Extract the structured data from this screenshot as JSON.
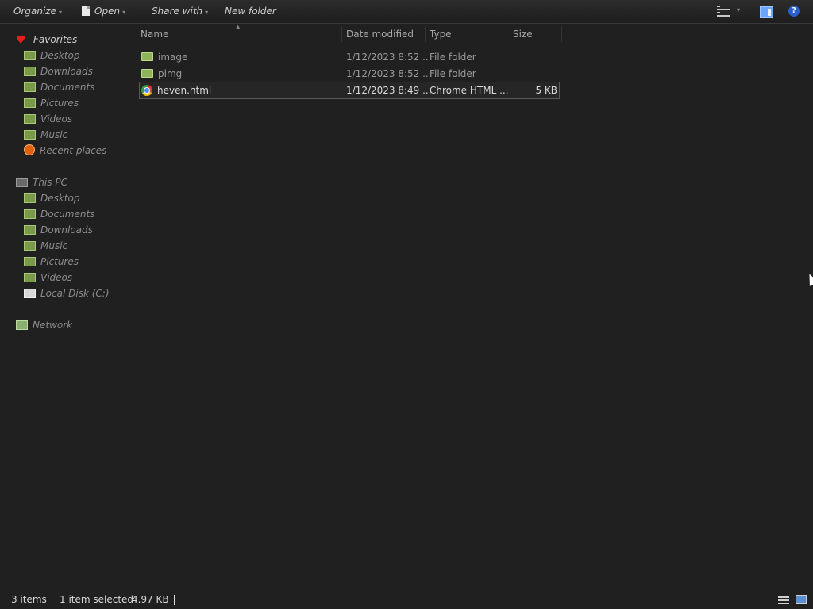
{
  "toolbar": {
    "organize": "Organize",
    "open": "Open",
    "share_with": "Share with",
    "new_folder": "New folder",
    "help_glyph": "?"
  },
  "nav": {
    "favorites": "Favorites",
    "favorites_items": [
      "Desktop",
      "Downloads",
      "Documents",
      "Pictures",
      "Videos",
      "Music",
      "Recent places"
    ],
    "this_pc": "This PC",
    "this_pc_items": [
      "Desktop",
      "Documents",
      "Downloads",
      "Music",
      "Pictures",
      "Videos",
      "Local Disk (C:)"
    ],
    "network": "Network"
  },
  "columns": {
    "name": "Name",
    "date_modified": "Date modified",
    "type": "Type",
    "size": "Size"
  },
  "files": [
    {
      "name": "image",
      "date": "1/12/2023 8:52 ...",
      "type": "File folder",
      "size": "",
      "icon": "folder-icon",
      "selected": false
    },
    {
      "name": "pimg",
      "date": "1/12/2023 8:52 ...",
      "type": "File folder",
      "size": "",
      "icon": "folder-icon",
      "selected": false
    },
    {
      "name": "heven.html",
      "date": "1/12/2023 8:49 ...",
      "type": "Chrome HTML ...",
      "size": "5 KB",
      "icon": "chrome-icon",
      "selected": true
    }
  ],
  "status": {
    "item_count": "3 items",
    "selection": "1 item selected",
    "selection_size": "4.97 KB"
  },
  "colors": {
    "background": "#202020",
    "favorites_heart": "#e0201a",
    "folder": "#8fb55a"
  }
}
